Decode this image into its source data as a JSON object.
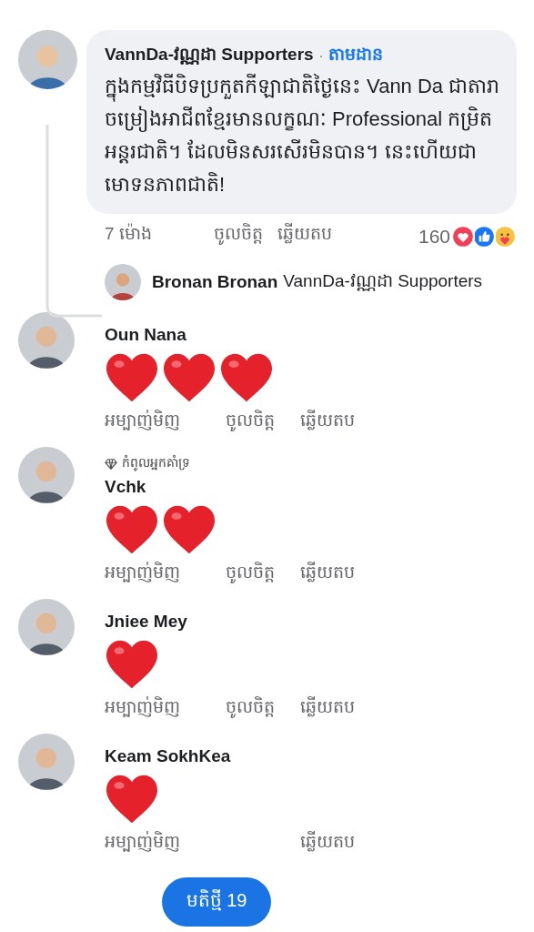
{
  "top_comment": {
    "author": "VannDa-វណ្ណដា Supporters",
    "separator": "·",
    "follow_label": "តាមដាន",
    "text": "ក្នុងកម្មវិធីបិទប្រកួតកីឡាជាតិថ្ងៃនេះ Vann Da ជាតារាចម្រៀងអាជីពខ្មែរមានលក្ខណៈ Professional កម្រិតអន្តរជាតិ។ ដែលមិនសរសើរមិនបាន។ នេះហើយជាមោទនភាពជាតិ!",
    "actions": [
      {
        "kind": "time",
        "label": "7 ម៉ោង"
      },
      {
        "kind": "like",
        "label": "ចូលចិត្ត"
      },
      {
        "kind": "reply",
        "label": "ឆ្លើយតប"
      }
    ],
    "reaction_count": "160",
    "reactions": [
      {
        "kind": "love"
      },
      {
        "kind": "like"
      },
      {
        "kind": "care"
      }
    ]
  },
  "reply_preview": {
    "author": "Bronan Bronan",
    "text": "VannDa-វណ្ណដា Supporters"
  },
  "comments": [
    {
      "author": "Oun Nana",
      "emojis": [
        {
          "kind": "heart"
        },
        {
          "kind": "heart"
        },
        {
          "kind": "heart"
        }
      ],
      "actions": [
        {
          "kind": "time",
          "label": "អម្បាញ់មិញ"
        },
        {
          "kind": "like",
          "label": "ចូលចិត្ត"
        },
        {
          "kind": "reply",
          "label": "ឆ្លើយតប"
        }
      ]
    },
    {
      "author": "Vchk",
      "badge": {
        "label": "កំពូលអ្នកគាំទ្រ"
      },
      "emojis": [
        {
          "kind": "heart"
        },
        {
          "kind": "heart"
        }
      ],
      "actions": [
        {
          "kind": "time",
          "label": "អម្បាញ់មិញ"
        },
        {
          "kind": "like",
          "label": "ចូលចិត្ត"
        },
        {
          "kind": "reply",
          "label": "ឆ្លើយតប"
        }
      ]
    },
    {
      "author": "Jniee Mey",
      "emojis": [
        {
          "kind": "heart"
        }
      ],
      "actions": [
        {
          "kind": "time",
          "label": "អម្បាញ់មិញ"
        },
        {
          "kind": "like",
          "label": "ចូលចិត្ត"
        },
        {
          "kind": "reply",
          "label": "ឆ្លើយតប"
        }
      ]
    },
    {
      "author": "Keam SokhKea",
      "emojis": [
        {
          "kind": "heart"
        }
      ],
      "actions": [
        {
          "kind": "time",
          "label": "អម្បាញ់មិញ"
        },
        {
          "kind": "reply",
          "label": "ឆ្លើយតប"
        }
      ]
    }
  ],
  "new_comments_button": {
    "label": "មតិថ្មី 19"
  }
}
